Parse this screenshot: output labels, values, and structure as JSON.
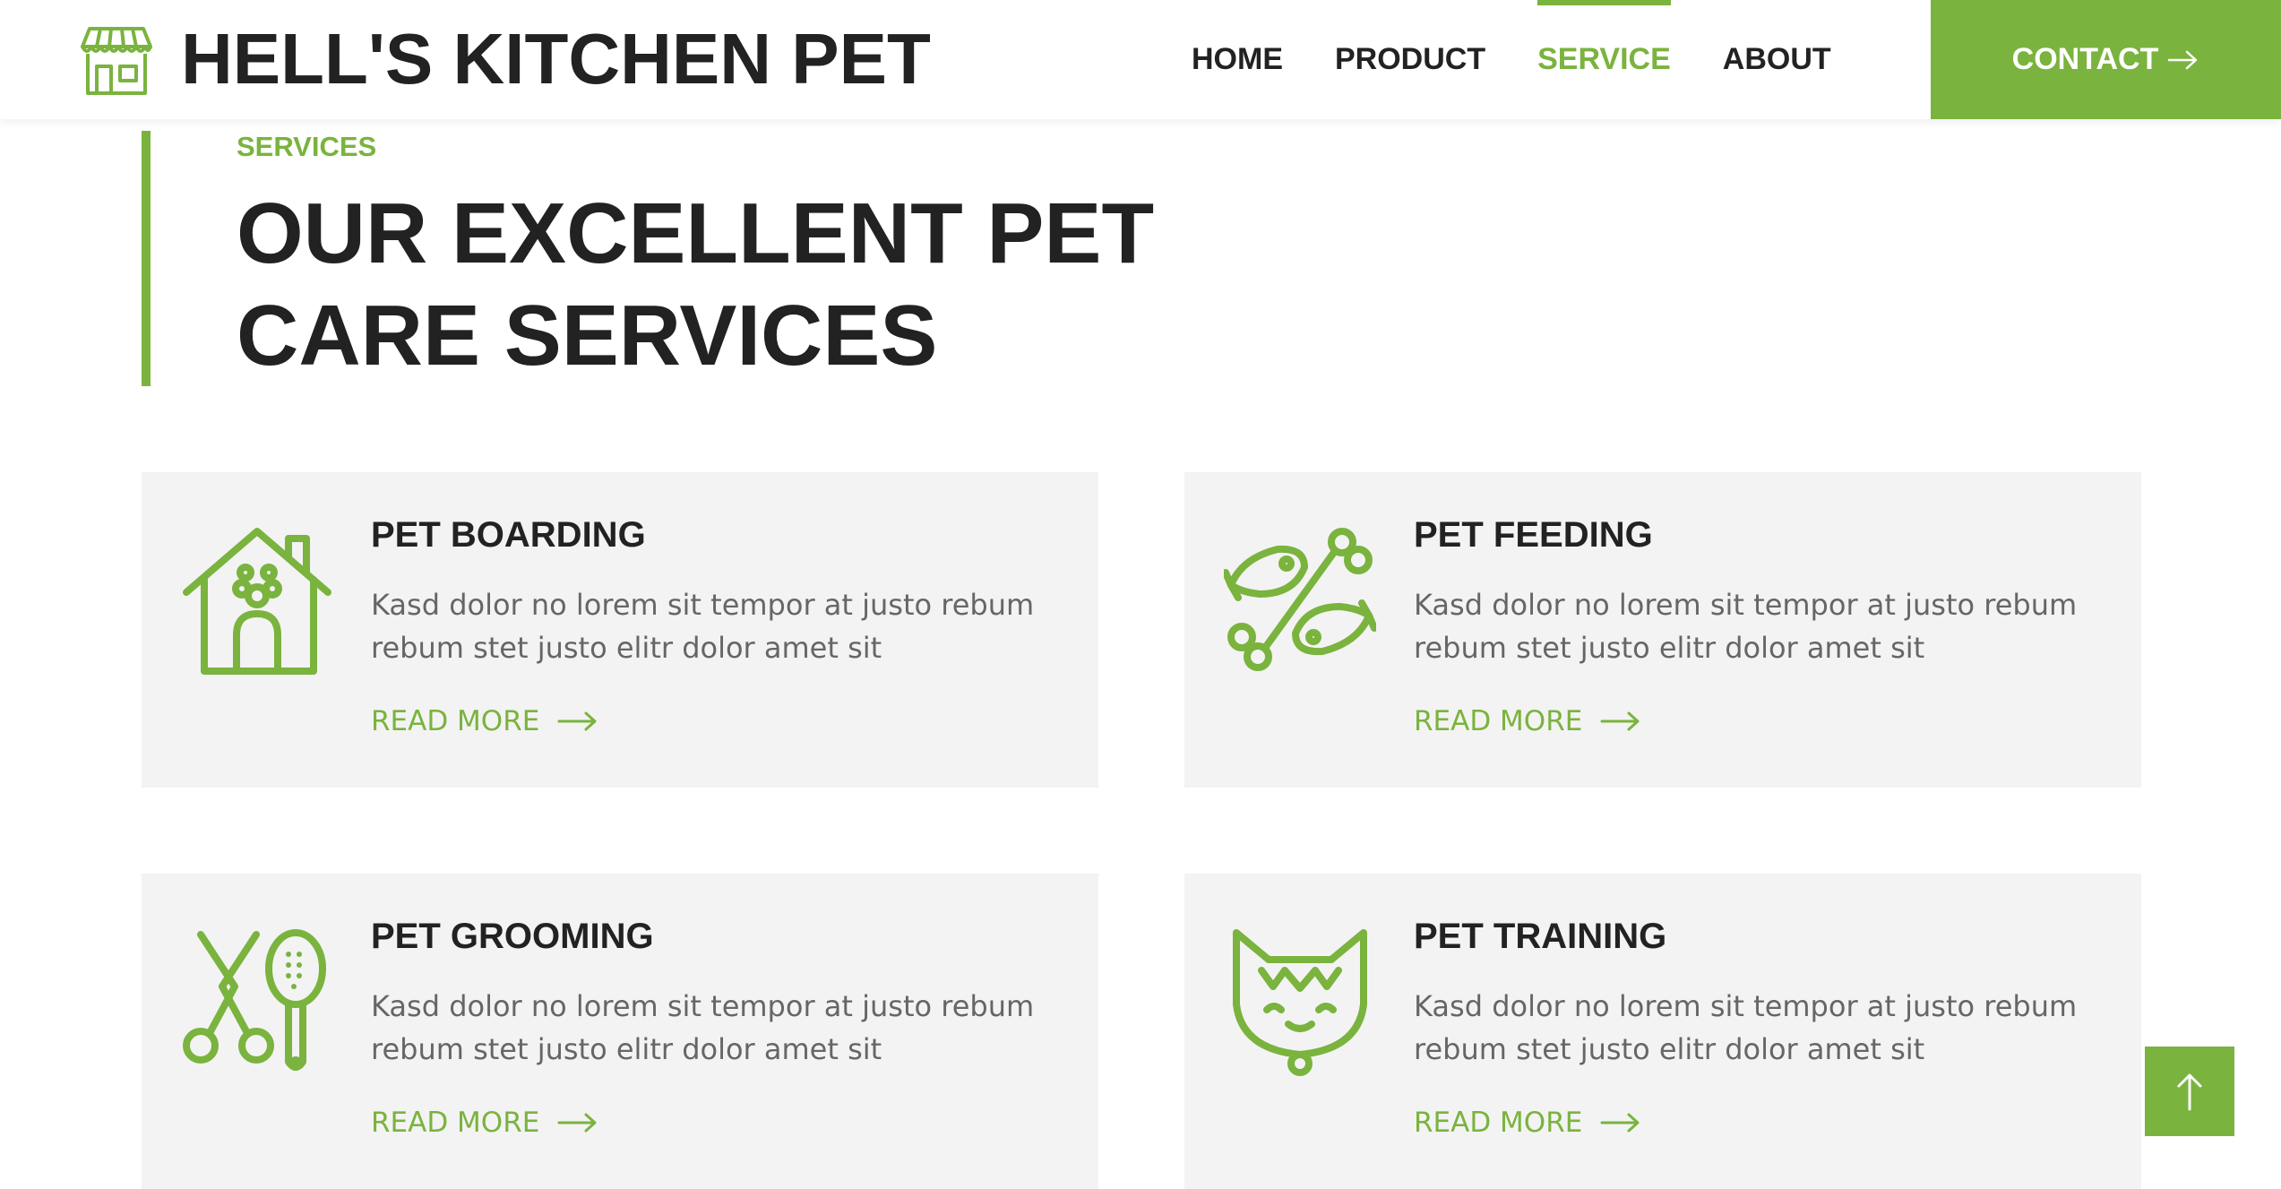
{
  "header": {
    "brand": "HELL'S KITCHEN PET",
    "brand_icon": "storefront-icon",
    "nav": [
      {
        "label": "HOME",
        "active": false
      },
      {
        "label": "PRODUCT",
        "active": false
      },
      {
        "label": "SERVICE",
        "active": true
      },
      {
        "label": "ABOUT",
        "active": false
      }
    ],
    "contact_label": "CONTACT",
    "contact_icon": "arrow-right-icon"
  },
  "section": {
    "eyebrow": "SERVICES",
    "title": "OUR EXCELLENT PET CARE SERVICES"
  },
  "services": [
    {
      "icon": "dog-house-icon",
      "title": "PET BOARDING",
      "text": "Kasd dolor no lorem sit tempor at justo rebum rebum stet justo elitr dolor amet sit",
      "link": "READ MORE"
    },
    {
      "icon": "fish-and-bone-icon",
      "title": "PET FEEDING",
      "text": "Kasd dolor no lorem sit tempor at justo rebum rebum stet justo elitr dolor amet sit",
      "link": "READ MORE"
    },
    {
      "icon": "scissors-and-brush-icon",
      "title": "PET GROOMING",
      "text": "Kasd dolor no lorem sit tempor at justo rebum rebum stet justo elitr dolor amet sit",
      "link": "READ MORE"
    },
    {
      "icon": "cat-face-icon",
      "title": "PET TRAINING",
      "text": "Kasd dolor no lorem sit tempor at justo rebum rebum stet justo elitr dolor amet sit",
      "link": "READ MORE"
    }
  ],
  "back_to_top_icon": "arrow-up-icon",
  "colors": {
    "accent": "#7ab33e",
    "text_dark": "#222222",
    "text_body": "#666666",
    "card_bg": "#f3f3f3"
  }
}
